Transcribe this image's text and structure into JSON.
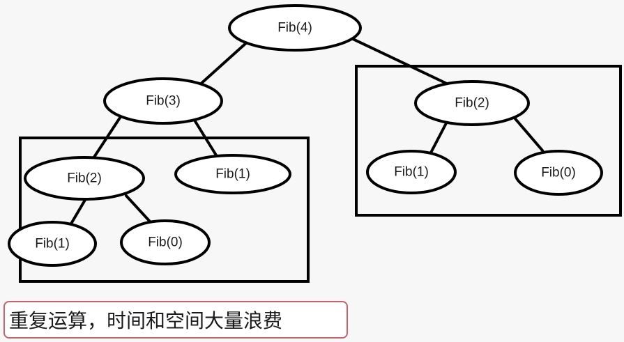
{
  "tree": {
    "nodes": [
      {
        "id": "n4",
        "label": "Fib(4)"
      },
      {
        "id": "n3",
        "label": "Fib(3)"
      },
      {
        "id": "n2r",
        "label": "Fib(2)"
      },
      {
        "id": "n2l",
        "label": "Fib(2)"
      },
      {
        "id": "n1m",
        "label": "Fib(1)"
      },
      {
        "id": "n1ll",
        "label": "Fib(1)"
      },
      {
        "id": "n0l",
        "label": "Fib(0)"
      },
      {
        "id": "n1r",
        "label": "Fib(1)"
      },
      {
        "id": "n0r",
        "label": "Fib(0)"
      }
    ],
    "edges": [
      {
        "from": "n4",
        "to": "n3"
      },
      {
        "from": "n4",
        "to": "n2r"
      },
      {
        "from": "n3",
        "to": "n2l"
      },
      {
        "from": "n3",
        "to": "n1m"
      },
      {
        "from": "n2l",
        "to": "n1ll"
      },
      {
        "from": "n2l",
        "to": "n0l"
      },
      {
        "from": "n2r",
        "to": "n1r"
      },
      {
        "from": "n2r",
        "to": "n0r"
      }
    ],
    "highlighted_groups": [
      {
        "id": "left-repeat-group",
        "members": [
          "n2l",
          "n1m",
          "n1ll",
          "n0l"
        ]
      },
      {
        "id": "right-repeat-group",
        "members": [
          "n2r",
          "n1r",
          "n0r"
        ]
      }
    ]
  },
  "caption": {
    "text": "重复运算，时间和空间大量浪费"
  }
}
